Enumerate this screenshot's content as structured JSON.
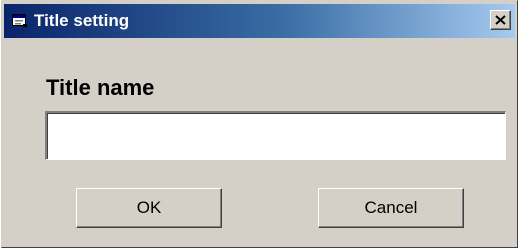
{
  "dialog": {
    "title": "Title setting",
    "icon": "window-app-icon",
    "close_icon": "close-x-icon",
    "field_label": "Title name",
    "title_input_value": "",
    "ok_label": "OK",
    "cancel_label": "Cancel"
  },
  "colors": {
    "titlebar_start": "#0a246a",
    "titlebar_end": "#a6caf0",
    "dialog_face": "#d4d0c8"
  }
}
